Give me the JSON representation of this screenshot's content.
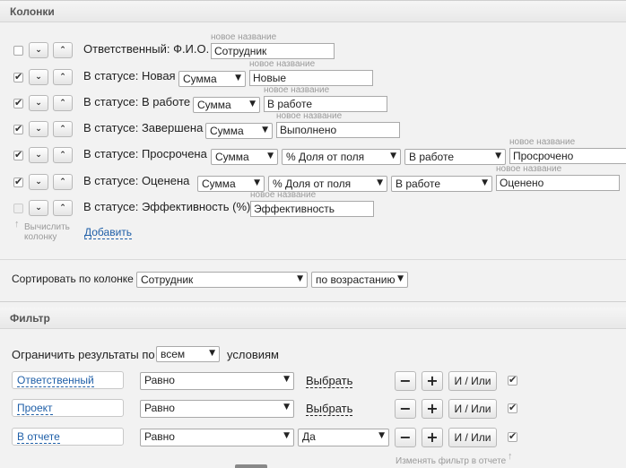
{
  "columns": {
    "header": "Колонки",
    "name_hint": "новое название",
    "rows": [
      {
        "checked": false,
        "label": "Ответственный: Ф.И.О.",
        "aggregate": "",
        "selects": [],
        "name": "Сотрудник"
      },
      {
        "checked": true,
        "label": "В статусе: Новая",
        "aggregate": "Сумма",
        "selects": [],
        "name": "Новые"
      },
      {
        "checked": true,
        "label": "В статусе: В работе",
        "aggregate": "Сумма",
        "selects": [],
        "name": "В работе"
      },
      {
        "checked": true,
        "label": "В статусе: Завершена",
        "aggregate": "Сумма",
        "selects": [],
        "name": "Выполнено"
      },
      {
        "checked": true,
        "label": "В статусе: Просрочена",
        "aggregate": "Сумма",
        "selects": [
          "% Доля от поля",
          "В работе"
        ],
        "name": "Просрочено"
      },
      {
        "checked": true,
        "label": "В статусе: Оценена",
        "aggregate": "Сумма",
        "selects": [
          "% Доля от поля",
          "В работе"
        ],
        "name": "Оценено"
      },
      {
        "checked": false,
        "label": "В статусе: Эффективность (%)",
        "aggregate": "",
        "selects": [],
        "name": "Эффективность"
      }
    ],
    "calc_hint_line1": "Вычислить",
    "calc_hint_line2": "колонку",
    "add_link": "Добавить"
  },
  "sort": {
    "label": "Сортировать по колонке",
    "column": "Сотрудник",
    "order": "по возрастанию"
  },
  "filter": {
    "header": "Фильтр",
    "limit_label": "Ограничить результаты по",
    "limit_value": "всем",
    "conditions_label": "условиям",
    "rows": [
      {
        "field": "Ответственный",
        "op": "Равно",
        "value_kind": "link",
        "value": "Выбрать",
        "logic": "И / Или",
        "checked": true
      },
      {
        "field": "Проект",
        "op": "Равно",
        "value_kind": "link",
        "value": "Выбрать",
        "logic": "И / Или",
        "checked": true
      },
      {
        "field": "В отчете",
        "op": "Равно",
        "value_kind": "select",
        "value": "Да",
        "logic": "И / Или",
        "checked": true
      }
    ],
    "minus": "−",
    "plus": "+",
    "footer_hint": "Изменять фильтр в отчете"
  }
}
